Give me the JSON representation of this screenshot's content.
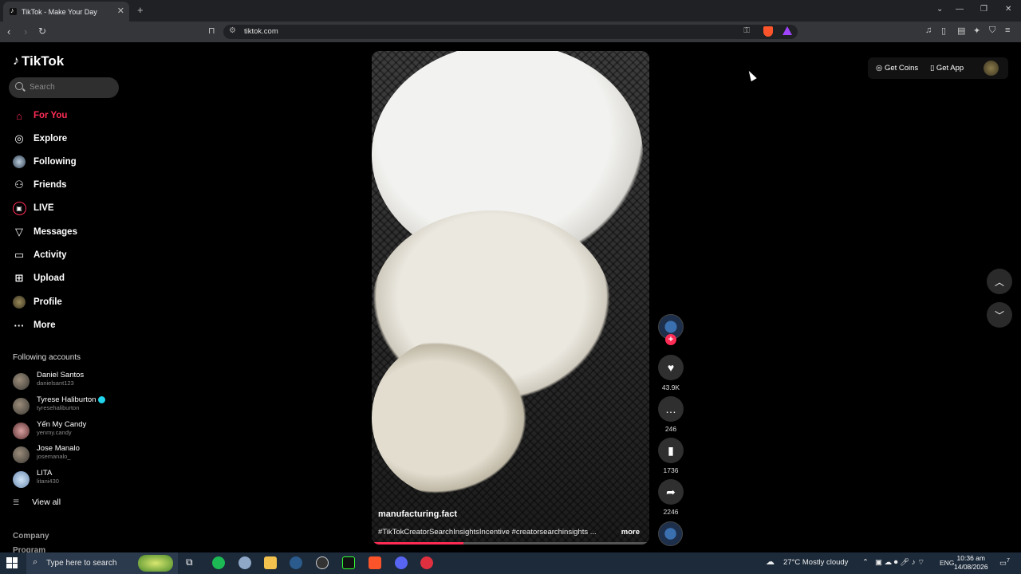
{
  "browser": {
    "tab_title": "TikTok - Make Your Day",
    "tab_close": "✕",
    "new_tab": "+",
    "url": "tiktok.com",
    "window_controls": [
      "⌄",
      "—",
      "❐",
      "✕"
    ]
  },
  "sidebar": {
    "logo": "TikTok",
    "search_placeholder": "Search",
    "nav": [
      {
        "label": "For You",
        "icon": "home-icon",
        "glyph": "⌂"
      },
      {
        "label": "Explore",
        "icon": "compass-icon",
        "glyph": "◎"
      },
      {
        "label": "Following",
        "icon": "following-avatar-icon",
        "glyph": "●"
      },
      {
        "label": "Friends",
        "icon": "friends-icon",
        "glyph": "⚇"
      },
      {
        "label": "LIVE",
        "icon": "live-icon",
        "glyph": "▣"
      },
      {
        "label": "Messages",
        "icon": "messages-icon",
        "glyph": "▽"
      },
      {
        "label": "Activity",
        "icon": "activity-icon",
        "glyph": "▭"
      },
      {
        "label": "Upload",
        "icon": "upload-icon",
        "glyph": "⊞"
      },
      {
        "label": "Profile",
        "icon": "profile-avatar-icon",
        "glyph": "●"
      },
      {
        "label": "More",
        "icon": "more-icon",
        "glyph": "···"
      }
    ],
    "following_title": "Following accounts",
    "accounts": [
      {
        "name": "Daniel Santos",
        "handle": "danielsant123"
      },
      {
        "name": "Tyrese Haliburton",
        "handle": "tyresehaliburton"
      },
      {
        "name": "Yến My Candy",
        "handle": "yenmy.candy"
      },
      {
        "name": "Jose Manalo",
        "handle": "josemanalo_"
      },
      {
        "name": "LITA",
        "handle": "litani430"
      }
    ],
    "view_all": "View all",
    "footer": [
      "Company",
      "Program"
    ]
  },
  "video": {
    "username": "manufacturing.fact",
    "caption": "#TikTokCreatorSearchInsightsIncentive #creatorsearchinsights ...",
    "more": "more",
    "progress": 0.33
  },
  "actions": {
    "likes": "43.9K",
    "comments": "246",
    "saves": "1736",
    "shares": "2246",
    "follow_plus": "+"
  },
  "top_right": {
    "get_coins": "Get Coins",
    "get_app": "Get App"
  },
  "taskbar": {
    "search_text": "Type here to search",
    "weather": "27°C  Mostly cloudy",
    "lang": "ENG",
    "time": "10:36 am",
    "date": "14/08/2026",
    "notifications": "7"
  },
  "colors": {
    "accent": "#fe2c55",
    "verified": "#20d5ec"
  }
}
